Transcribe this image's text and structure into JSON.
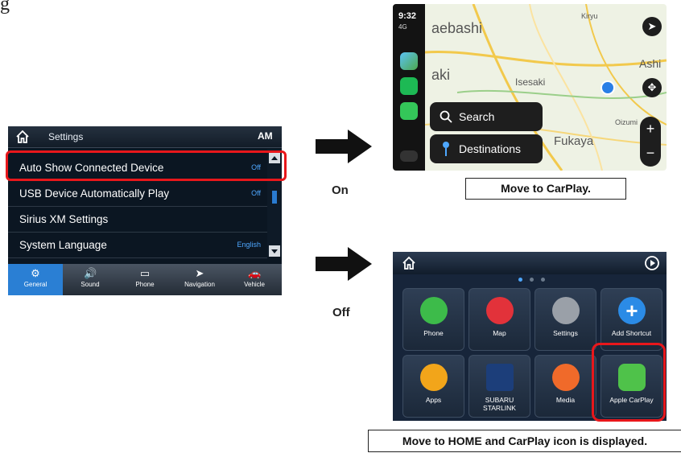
{
  "top_caption": "g",
  "settings": {
    "title": "Settings",
    "source": "AM",
    "rows": [
      {
        "label": "Auto Show Connected Device",
        "value": "Off"
      },
      {
        "label": "USB Device Automatically Play",
        "value": "Off"
      },
      {
        "label": "Sirius XM Settings",
        "value": ""
      },
      {
        "label": "System Language",
        "value": "English"
      }
    ],
    "tabs": [
      {
        "label": "General",
        "icon": "gear-icon"
      },
      {
        "label": "Sound",
        "icon": "speaker-icon"
      },
      {
        "label": "Phone",
        "icon": "phone-icon"
      },
      {
        "label": "Navigation",
        "icon": "navigation-icon"
      },
      {
        "label": "Vehicle",
        "icon": "car-icon"
      }
    ],
    "active_tab": "General"
  },
  "arrows": {
    "on_label": "On",
    "off_label": "Off"
  },
  "carplay": {
    "time": "9:32",
    "signal": "4G",
    "search_label": "Search",
    "destinations_label": "Destinations",
    "map_places": [
      "aebashi",
      "aki",
      "Isesaki",
      "Fukaya",
      "Ashi",
      "Oizumi",
      "Kiryu"
    ],
    "caption": "Move to CarPlay."
  },
  "home": {
    "tiles": [
      {
        "label": "Phone",
        "color": "#3dbb4a"
      },
      {
        "label": "Map",
        "color": "#e2323a"
      },
      {
        "label": "Settings",
        "color": "#9aa0a8"
      },
      {
        "label": "Add Shortcut",
        "color": "#2b8be6"
      },
      {
        "label": "Apps",
        "color": "#f2a51a"
      },
      {
        "label": "SUBARU STARLINK",
        "color": "#1c3e7a"
      },
      {
        "label": "Media",
        "color": "#f06a2a"
      },
      {
        "label": "Apple CarPlay",
        "color": "#4fc24a"
      }
    ],
    "caption": "Move to HOME and CarPlay icon is displayed."
  },
  "colors": {
    "highlight": "#e8171b",
    "accent": "#2a7fd4"
  }
}
